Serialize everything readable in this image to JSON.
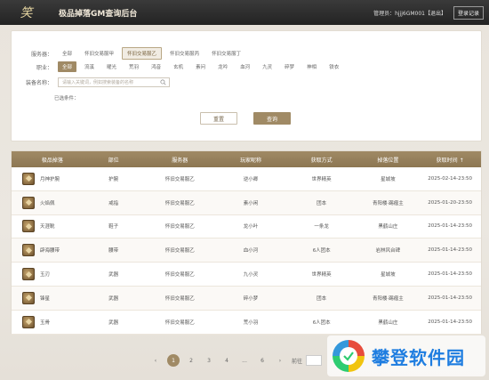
{
  "header": {
    "app_title": "极品掉落GM查询后台",
    "account_label": "管理员：hjjj6GM001【退出】",
    "logout_label": "登录记录"
  },
  "filters": {
    "server": {
      "label": "服务器：",
      "options": [
        "全部",
        "怀旧交易服甲",
        "怀旧交易服乙",
        "怀旧交易服丙",
        "怀旧交易服丁"
      ],
      "selected_index": 2
    },
    "profession": {
      "label": "职业：",
      "options": [
        "全部",
        "流溪",
        "曜光",
        "荒羽",
        "鸿音",
        "玄机",
        "素问",
        "龙吟",
        "血河",
        "九灵",
        "碎梦",
        "神相",
        "铁衣"
      ],
      "selected_index": 0
    },
    "equipment": {
      "label": "装备名称：",
      "placeholder": "请输入关键词，例如搜索装备的名称"
    },
    "conditions_label": "已选条件：",
    "reset_label": "重置",
    "query_label": "查询"
  },
  "table": {
    "columns": [
      "极品掉落",
      "部位",
      "服务器",
      "玩家昵称",
      "获取方式",
      "掉落位置",
      "获取时间 ↑"
    ],
    "rows": [
      {
        "item": "月神护腕",
        "slot": "护腕",
        "server": "怀旧交易服乙",
        "player": "逆小卿",
        "method": "世界精英",
        "location": "星城坡",
        "time": "2025-02-14-23:50"
      },
      {
        "item": "火焰佩",
        "slot": "戒指",
        "server": "怀旧交易服乙",
        "player": "素小闲",
        "method": "团本",
        "location": "青阳楼·踢瘤主",
        "time": "2025-01-20-23:50"
      },
      {
        "item": "天涯靴",
        "slot": "鞋子",
        "server": "怀旧交易服乙",
        "player": "龙小叶",
        "method": "一条龙",
        "location": "黑鹤山庄",
        "time": "2025-01-14-23:50"
      },
      {
        "item": "辟海腰带",
        "slot": "腰带",
        "server": "怀旧交易服乙",
        "player": "血小河",
        "method": "6人团本",
        "location": "岩林风台碑",
        "time": "2025-01-14-23:50"
      },
      {
        "item": "玉刃",
        "slot": "武器",
        "server": "怀旧交易服乙",
        "player": "九小灵",
        "method": "世界精英",
        "location": "星城坡",
        "time": "2025-01-14-23:50"
      },
      {
        "item": "锋星",
        "slot": "武器",
        "server": "怀旧交易服乙",
        "player": "碎小梦",
        "method": "团本",
        "location": "青阳楼·踢瘤主",
        "time": "2025-01-14-23:50"
      },
      {
        "item": "玉骨",
        "slot": "武器",
        "server": "怀旧交易服乙",
        "player": "荒小羽",
        "method": "6人团本",
        "location": "黑鹤山庄",
        "time": "2025-01-14-23:50"
      }
    ]
  },
  "pager": {
    "prev": "‹",
    "pages": [
      "1",
      "2",
      "3",
      "4",
      "...",
      "6"
    ],
    "next": "›",
    "goto_label": "前往"
  },
  "watermark": {
    "text": "攀登软件园"
  },
  "colors": {
    "accent": "#a08a65",
    "header_bg": "#2a2a2a"
  }
}
